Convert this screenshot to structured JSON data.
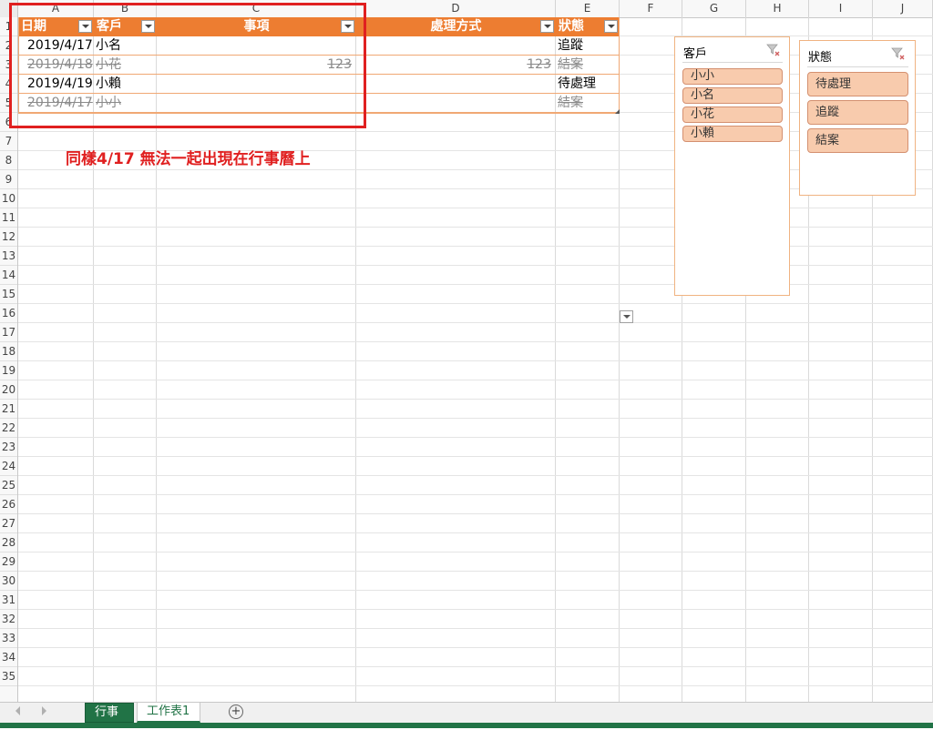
{
  "columns": [
    "A",
    "B",
    "C",
    "D",
    "E",
    "F",
    "G",
    "H",
    "I",
    "J"
  ],
  "rows": [
    "1",
    "2",
    "3",
    "4",
    "5",
    "6",
    "7",
    "8",
    "9",
    "10",
    "11",
    "12",
    "13",
    "14",
    "15",
    "16",
    "17",
    "18",
    "19",
    "20",
    "21",
    "22",
    "23",
    "24",
    "25",
    "26",
    "27",
    "28",
    "29",
    "30",
    "31",
    "32",
    "33",
    "34",
    "35"
  ],
  "table": {
    "headers": {
      "date": "日期",
      "client": "客戶",
      "item": "事項",
      "method": "處理方式",
      "status": "狀態"
    },
    "rows": [
      {
        "date": "2019/4/17",
        "client": "小名",
        "item": "",
        "method": "",
        "status": "追蹤",
        "struck": false
      },
      {
        "date": "2019/4/18",
        "client": "小花",
        "item": "123",
        "method": "123",
        "status": "結案",
        "struck": true
      },
      {
        "date": "2019/4/19",
        "client": "小賴",
        "item": "",
        "method": "",
        "status": "待處理",
        "struck": false
      },
      {
        "date": "2019/4/17",
        "client": "小小",
        "item": "",
        "method": "",
        "status": "結案",
        "struck": true
      }
    ]
  },
  "annotation": "同樣4/17 無法一起出現在行事曆上",
  "slicers": {
    "client": {
      "title": "客戶",
      "items": [
        "小小",
        "小名",
        "小花",
        "小賴"
      ]
    },
    "status": {
      "title": "狀態",
      "items": [
        "待處理",
        "追蹤",
        "結案"
      ]
    }
  },
  "sheet_tabs": [
    "行事曆",
    "工作表1"
  ],
  "active_tab": "工作表1",
  "colors": {
    "table_header": "#ed7d31",
    "highlight": "#e02020",
    "slicer_item": "#f8cbad",
    "excel_green": "#217346"
  }
}
